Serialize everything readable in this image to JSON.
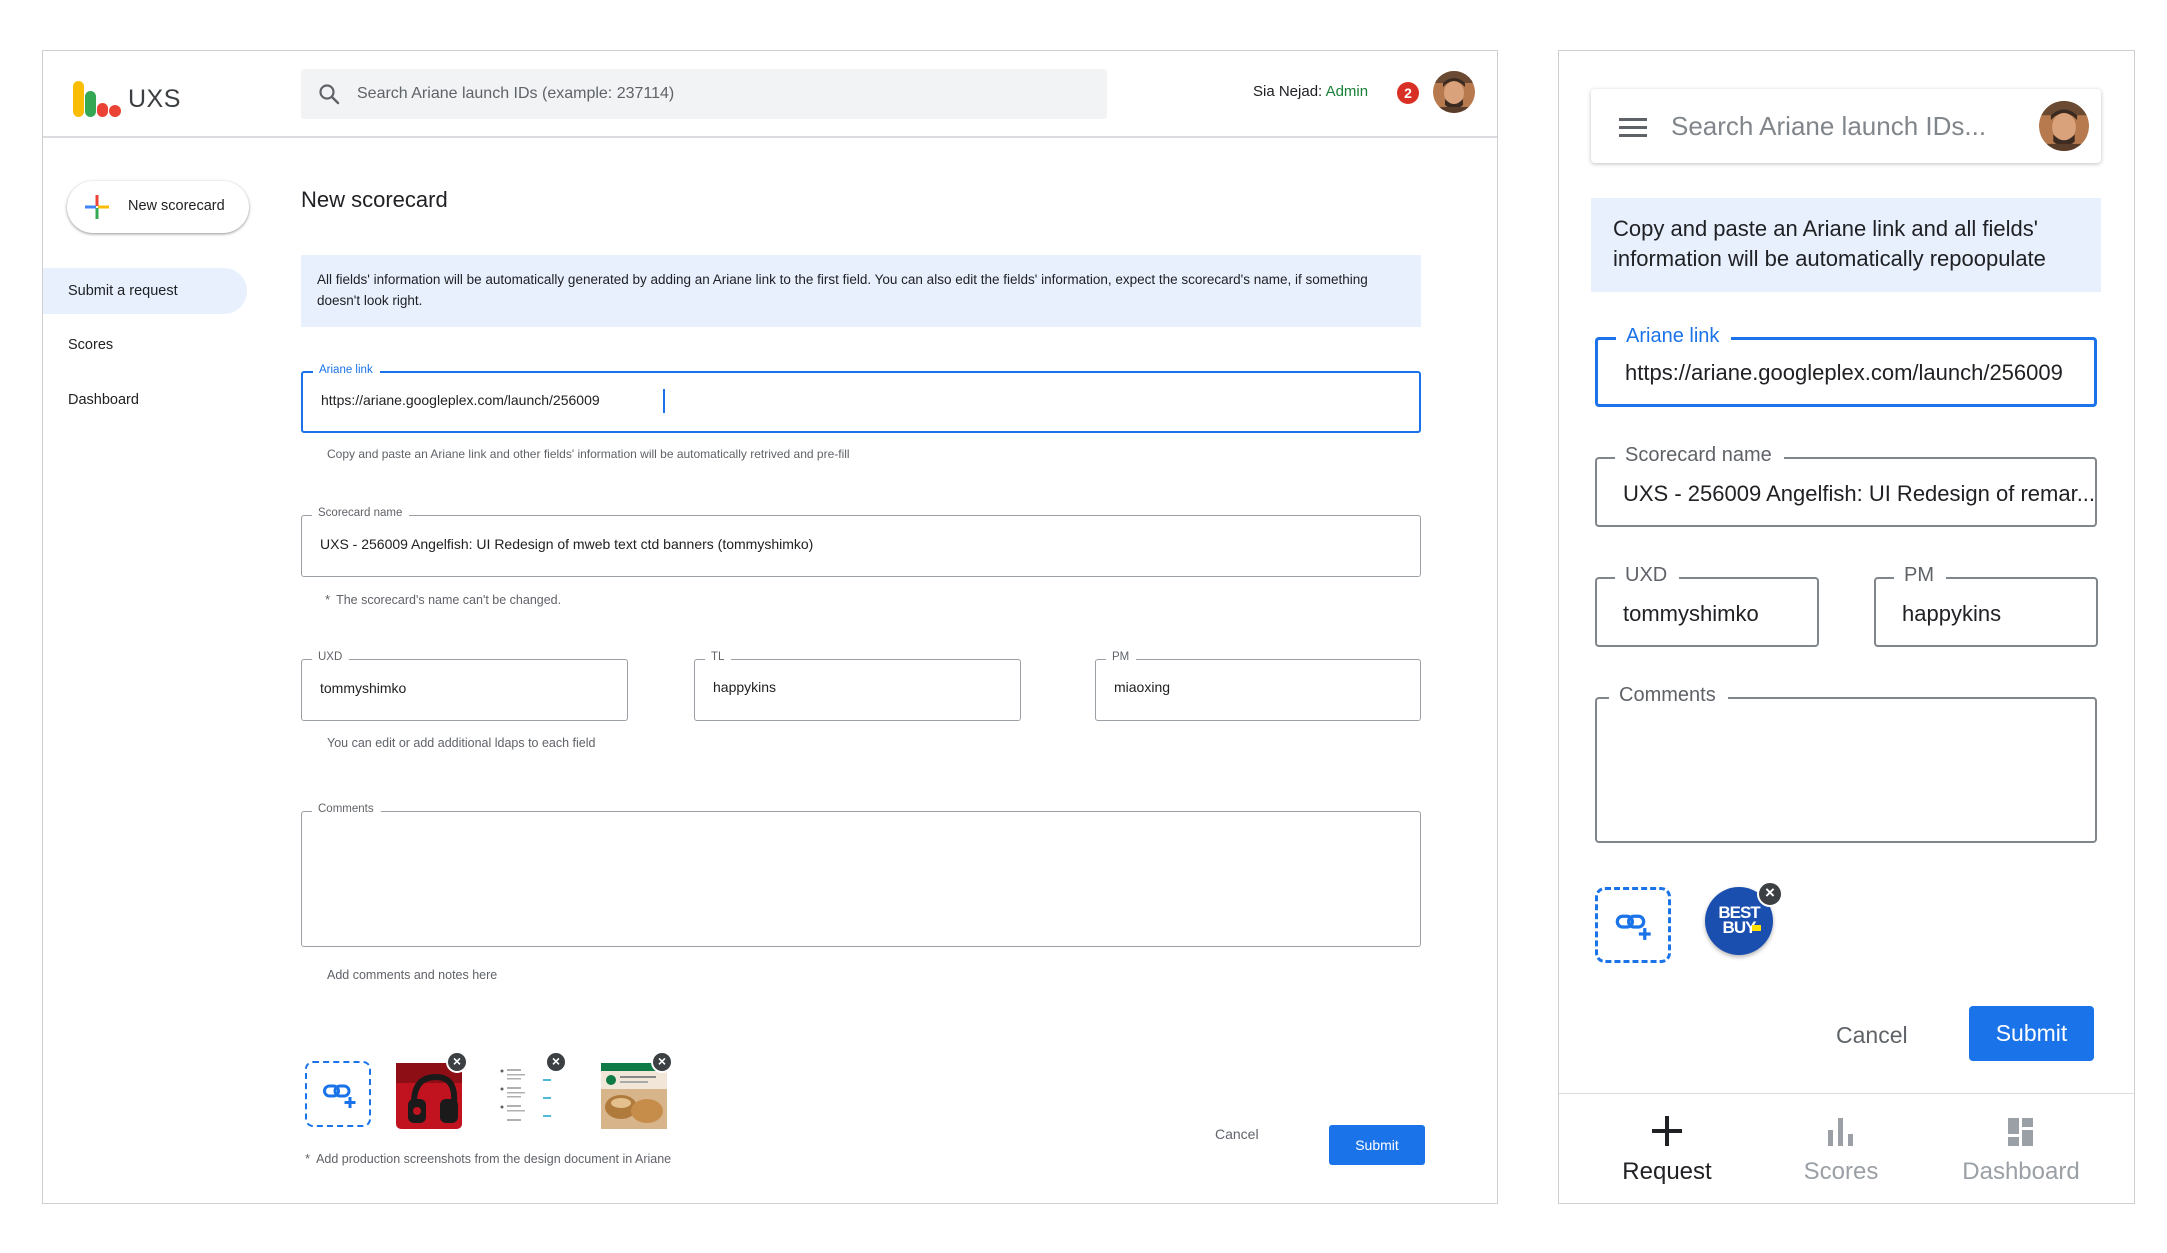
{
  "desktop": {
    "app_name": "UXS",
    "search_placeholder": "Search Ariane launch IDs (example: 237114)",
    "user_name": "Sia Nejad:",
    "user_role": "Admin",
    "notification_count": "2",
    "new_button_label": "New scorecard",
    "nav": [
      {
        "label": "Submit a request",
        "active": true
      },
      {
        "label": "Scores",
        "active": false
      },
      {
        "label": "Dashboard",
        "active": false
      }
    ],
    "page_title": "New scorecard",
    "info_text": "All fields' information will be automatically generated by adding an Ariane link to the first field. You can also edit the fields' information, expect the scorecard's name, if something doesn't look right.",
    "ariane": {
      "label": "Ariane link",
      "value": "https://ariane.googleplex.com/launch/256009",
      "help": "Copy and paste an Ariane link and other fields' information will be automatically retrived and pre-fill"
    },
    "scorecard": {
      "label": "Scorecard name",
      "value": "UXS - 256009 Angelfish: UI Redesign of mweb text ctd banners (tommyshimko)",
      "help_star": "*",
      "help": "The scorecard's name can't be changed."
    },
    "uxd": {
      "label": "UXD",
      "value": "tommyshimko"
    },
    "tl": {
      "label": "TL",
      "value": "happykins"
    },
    "pm": {
      "label": "PM",
      "value": "miaoxing"
    },
    "ldap_help": "You can edit or add additional ldaps to each field",
    "comments": {
      "label": "Comments",
      "value": "",
      "help": "Add comments and notes here"
    },
    "screenshots_star": "*",
    "screenshots_help": "Add production screenshots from the design document in Ariane",
    "cancel_label": "Cancel",
    "submit_label": "Submit",
    "close_glyph": "×"
  },
  "mobile": {
    "search_placeholder": "Search Ariane launch IDs...",
    "info_text": "Copy and paste an Ariane link and all fields' information will be automatically repoopulate",
    "ariane": {
      "label": "Ariane link",
      "value": "https://ariane.googleplex.com/launch/256009"
    },
    "scorecard": {
      "label": "Scorecard name",
      "value": "UXS - 256009 Angelfish: UI Redesign of remar..."
    },
    "uxd": {
      "label": "UXD",
      "value": "tommyshimko"
    },
    "pm": {
      "label": "PM",
      "value": "happykins"
    },
    "comments": {
      "label": "Comments",
      "value": ""
    },
    "bestbuy_logo": "BEST BUY",
    "close_glyph": "×",
    "cancel_label": "Cancel",
    "submit_label": "Submit",
    "nav": [
      {
        "label": "Request",
        "icon": "plus-icon",
        "active": true
      },
      {
        "label": "Scores",
        "icon": "bar-chart-icon",
        "active": false
      },
      {
        "label": "Dashboard",
        "icon": "dashboard-icon",
        "active": false
      }
    ]
  },
  "colors": {
    "accent": "#1a73e8",
    "admin": "#188038",
    "badge": "#d93025",
    "info_bg": "#e8f0fe"
  }
}
